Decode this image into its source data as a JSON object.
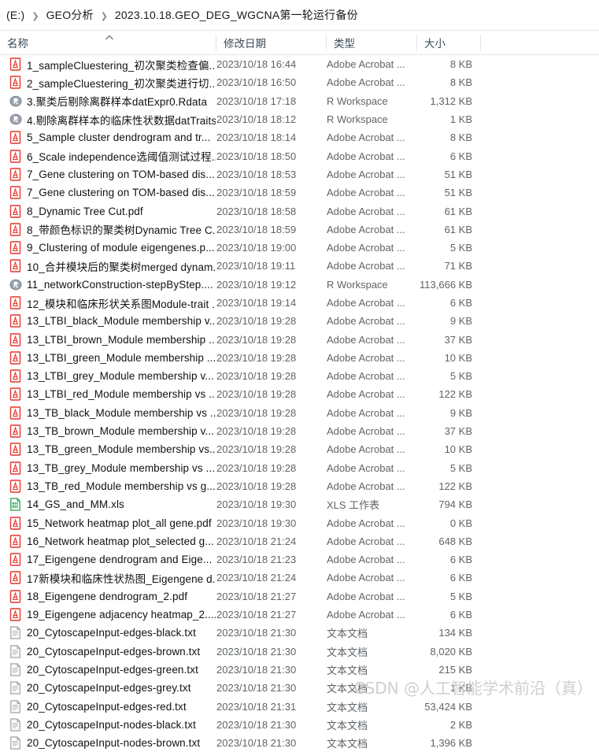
{
  "breadcrumb": {
    "separator": "❯",
    "items": [
      {
        "label": "(E:)"
      },
      {
        "label": "GEO分析"
      },
      {
        "label": "2023.10.18.GEO_DEG_WGCNA第一轮运行备份"
      }
    ]
  },
  "columns": {
    "name": "名称",
    "date": "修改日期",
    "type": "类型",
    "size": "大小",
    "sort_caret": "⌃"
  },
  "watermark": "CSDN @人工智能学术前沿（真）",
  "types": {
    "pdf": "Adobe Acrobat ...",
    "rdata": "R Workspace",
    "xls": "XLS 工作表",
    "txt": "文本文档"
  },
  "files": [
    {
      "icon": "pdf-file-icon",
      "name": "1_sampleCluestering_初次聚类检查偏...",
      "date": "2023/10/18 16:44",
      "type": "Adobe Acrobat ...",
      "size": "8 KB"
    },
    {
      "icon": "pdf-file-icon",
      "name": "2_sampleCluestering_初次聚类进行切...",
      "date": "2023/10/18 16:50",
      "type": "Adobe Acrobat ...",
      "size": "8 KB"
    },
    {
      "icon": "rdata-file-icon",
      "name": "3.聚类后剔除离群样本datExpr0.Rdata",
      "date": "2023/10/18 17:18",
      "type": "R Workspace",
      "size": "1,312 KB"
    },
    {
      "icon": "rdata-file-icon",
      "name": "4.剔除离群样本的临床性状数据datTraits...",
      "date": "2023/10/18 18:12",
      "type": "R Workspace",
      "size": "1 KB"
    },
    {
      "icon": "pdf-file-icon",
      "name": "5_Sample cluster dendrogram and tr...",
      "date": "2023/10/18 18:14",
      "type": "Adobe Acrobat ...",
      "size": "8 KB"
    },
    {
      "icon": "pdf-file-icon",
      "name": "6_Scale independence选阈值测试过程...",
      "date": "2023/10/18 18:50",
      "type": "Adobe Acrobat ...",
      "size": "6 KB"
    },
    {
      "icon": "pdf-file-icon",
      "name": "7_Gene clustering on TOM-based dis...",
      "date": "2023/10/18 18:53",
      "type": "Adobe Acrobat ...",
      "size": "51 KB"
    },
    {
      "icon": "pdf-file-icon",
      "name": "7_Gene clustering on TOM-based dis...",
      "date": "2023/10/18 18:59",
      "type": "Adobe Acrobat ...",
      "size": "51 KB"
    },
    {
      "icon": "pdf-file-icon",
      "name": "8_Dynamic Tree Cut.pdf",
      "date": "2023/10/18 18:58",
      "type": "Adobe Acrobat ...",
      "size": "61 KB"
    },
    {
      "icon": "pdf-file-icon",
      "name": "8_带颜色标识的聚类树Dynamic Tree C...",
      "date": "2023/10/18 18:59",
      "type": "Adobe Acrobat ...",
      "size": "61 KB"
    },
    {
      "icon": "pdf-file-icon",
      "name": "9_Clustering of module eigengenes.p...",
      "date": "2023/10/18 19:00",
      "type": "Adobe Acrobat ...",
      "size": "5 KB"
    },
    {
      "icon": "pdf-file-icon",
      "name": "10_合并模块后的聚类树merged dynam...",
      "date": "2023/10/18 19:11",
      "type": "Adobe Acrobat ...",
      "size": "71 KB"
    },
    {
      "icon": "rdata-file-icon",
      "name": "11_networkConstruction-stepByStep....",
      "date": "2023/10/18 19:12",
      "type": "R Workspace",
      "size": "113,666 KB"
    },
    {
      "icon": "pdf-file-icon",
      "name": "12_模块和临床形状关系图Module-trait ...",
      "date": "2023/10/18 19:14",
      "type": "Adobe Acrobat ...",
      "size": "6 KB"
    },
    {
      "icon": "pdf-file-icon",
      "name": "13_LTBI_black_Module membership v...",
      "date": "2023/10/18 19:28",
      "type": "Adobe Acrobat ...",
      "size": "9 KB"
    },
    {
      "icon": "pdf-file-icon",
      "name": "13_LTBI_brown_Module membership ...",
      "date": "2023/10/18 19:28",
      "type": "Adobe Acrobat ...",
      "size": "37 KB"
    },
    {
      "icon": "pdf-file-icon",
      "name": "13_LTBI_green_Module membership ...",
      "date": "2023/10/18 19:28",
      "type": "Adobe Acrobat ...",
      "size": "10 KB"
    },
    {
      "icon": "pdf-file-icon",
      "name": "13_LTBI_grey_Module membership v...",
      "date": "2023/10/18 19:28",
      "type": "Adobe Acrobat ...",
      "size": "5 KB"
    },
    {
      "icon": "pdf-file-icon",
      "name": "13_LTBI_red_Module membership vs ...",
      "date": "2023/10/18 19:28",
      "type": "Adobe Acrobat ...",
      "size": "122 KB"
    },
    {
      "icon": "pdf-file-icon",
      "name": "13_TB_black_Module membership vs ...",
      "date": "2023/10/18 19:28",
      "type": "Adobe Acrobat ...",
      "size": "9 KB"
    },
    {
      "icon": "pdf-file-icon",
      "name": "13_TB_brown_Module membership v...",
      "date": "2023/10/18 19:28",
      "type": "Adobe Acrobat ...",
      "size": "37 KB"
    },
    {
      "icon": "pdf-file-icon",
      "name": "13_TB_green_Module membership vs...",
      "date": "2023/10/18 19:28",
      "type": "Adobe Acrobat ...",
      "size": "10 KB"
    },
    {
      "icon": "pdf-file-icon",
      "name": "13_TB_grey_Module membership vs ...",
      "date": "2023/10/18 19:28",
      "type": "Adobe Acrobat ...",
      "size": "5 KB"
    },
    {
      "icon": "pdf-file-icon",
      "name": "13_TB_red_Module membership vs g...",
      "date": "2023/10/18 19:28",
      "type": "Adobe Acrobat ...",
      "size": "122 KB"
    },
    {
      "icon": "xls-file-icon",
      "name": "14_GS_and_MM.xls",
      "date": "2023/10/18 19:30",
      "type": "XLS 工作表",
      "size": "794 KB"
    },
    {
      "icon": "pdf-file-icon",
      "name": "15_Network heatmap plot_all gene.pdf",
      "date": "2023/10/18 19:30",
      "type": "Adobe Acrobat ...",
      "size": "0 KB"
    },
    {
      "icon": "pdf-file-icon",
      "name": "16_Network heatmap plot_selected g...",
      "date": "2023/10/18 21:24",
      "type": "Adobe Acrobat ...",
      "size": "648 KB"
    },
    {
      "icon": "pdf-file-icon",
      "name": "17_Eigengene dendrogram and Eige...",
      "date": "2023/10/18 21:23",
      "type": "Adobe Acrobat ...",
      "size": "6 KB"
    },
    {
      "icon": "pdf-file-icon",
      "name": "17新模块和临床性状热图_Eigengene d...",
      "date": "2023/10/18 21:24",
      "type": "Adobe Acrobat ...",
      "size": "6 KB"
    },
    {
      "icon": "pdf-file-icon",
      "name": "18_Eigengene dendrogram_2.pdf",
      "date": "2023/10/18 21:27",
      "type": "Adobe Acrobat ...",
      "size": "5 KB"
    },
    {
      "icon": "pdf-file-icon",
      "name": "19_Eigengene adjacency heatmap_2....",
      "date": "2023/10/18 21:27",
      "type": "Adobe Acrobat ...",
      "size": "6 KB"
    },
    {
      "icon": "txt-file-icon",
      "name": "20_CytoscapeInput-edges-black.txt",
      "date": "2023/10/18 21:30",
      "type": "文本文档",
      "size": "134 KB"
    },
    {
      "icon": "txt-file-icon",
      "name": "20_CytoscapeInput-edges-brown.txt",
      "date": "2023/10/18 21:30",
      "type": "文本文档",
      "size": "8,020 KB"
    },
    {
      "icon": "txt-file-icon",
      "name": "20_CytoscapeInput-edges-green.txt",
      "date": "2023/10/18 21:30",
      "type": "文本文档",
      "size": "215 KB"
    },
    {
      "icon": "txt-file-icon",
      "name": "20_CytoscapeInput-edges-grey.txt",
      "date": "2023/10/18 21:30",
      "type": "文本文档",
      "size": "1 KB"
    },
    {
      "icon": "txt-file-icon",
      "name": "20_CytoscapeInput-edges-red.txt",
      "date": "2023/10/18 21:31",
      "type": "文本文档",
      "size": "53,424 KB"
    },
    {
      "icon": "txt-file-icon",
      "name": "20_CytoscapeInput-nodes-black.txt",
      "date": "2023/10/18 21:30",
      "type": "文本文档",
      "size": "2 KB"
    },
    {
      "icon": "txt-file-icon",
      "name": "20_CytoscapeInput-nodes-brown.txt",
      "date": "2023/10/18 21:30",
      "type": "文本文档",
      "size": "1,396 KB"
    }
  ]
}
